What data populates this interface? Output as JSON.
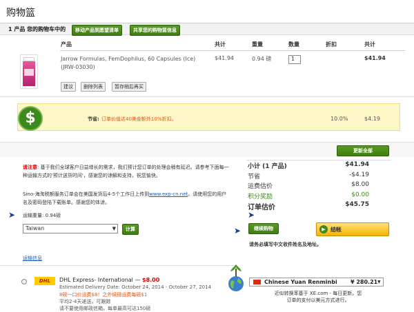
{
  "page": {
    "title": "购物篮"
  },
  "toolbar": {
    "cart_count": "1 产品 您的购物车中的",
    "move_wishlist": "移动产品到愿望清单",
    "share_cart": "共享您的购物篮信息"
  },
  "table": {
    "headers": {
      "product": "产品",
      "total1": "共计",
      "weight": "重量",
      "qty": "数量",
      "discount": "折扣",
      "total2": "共计"
    },
    "row": {
      "name": "Jarrow Formulas, FemDophilus, 60 Capsules (Ice) (JRW-03030)",
      "price": "$41.94",
      "weight": "0.94 磅",
      "qty": "1",
      "total": "$41.94",
      "actions": [
        "建议",
        "删除列表",
        "暂存稍后再买"
      ]
    }
  },
  "promo": {
    "label": "节省:",
    "text": "订单价值达40美金额外10%折扣。",
    "percent": "10.0%",
    "amount": "$4.19"
  },
  "update_button": "更新全部",
  "notice": {
    "prefix": "请注意",
    "text1": ": 基于我们全球客户日益增长的需求，我们预计您订单的处理会稍有延迟。请参考下面每一种运输方式的'预计送货时间'，感谢您的谅解和支持，祝您愉快。",
    "text2a": "Sino-海淘税额服务订单会在美国发货后4-5个工作日上传到",
    "link": "www.exp-cn.net",
    "text2b": "。请使用您的用户名及密码登陆下载账单。感谢您的体谅。"
  },
  "shipping": {
    "weight_label": "运输重量: 0.94磅",
    "country": "Taiwan",
    "calc_button": "计算",
    "info_link": "运输信息",
    "option": {
      "carrier_logo": "DHL",
      "name": "DHL Express- International —",
      "price": "$8.00",
      "delivery": "Estimated Delivery Date: October 24, 2014 - October 27, 2014",
      "promo": "8磅一口价运费$8！之外续磅运费每磅$1",
      "avg": "平均2-4天递送，可跟踪",
      "note": "请不要使用邮政信箱，每单最高可达150磅"
    }
  },
  "summary": {
    "subtotal_label": "小计 (1 产品)",
    "subtotal": "$41.94",
    "save_label": "节省",
    "save": "-$4.19",
    "ship_label": "运费估价",
    "ship": "$8.00",
    "reward_label": "积分奖励",
    "reward": "$0.00",
    "total_label": "订单估价",
    "total": "$45.75"
  },
  "actions": {
    "continue": "继续购物",
    "checkout": "结帐",
    "checkout_note": "请务必填写中文收件姓名及地址。"
  },
  "currency": {
    "name": "Chinese Yuan Renminbi",
    "amount": "¥ 280.21",
    "note": "近似转换率基于 XE.com - 每日更新。您订单的支付以美元方式进行。"
  },
  "colors": {
    "accent_green": "#4a8a1c",
    "promo_orange": "#e8520f",
    "link_blue": "#1a5fb4"
  }
}
